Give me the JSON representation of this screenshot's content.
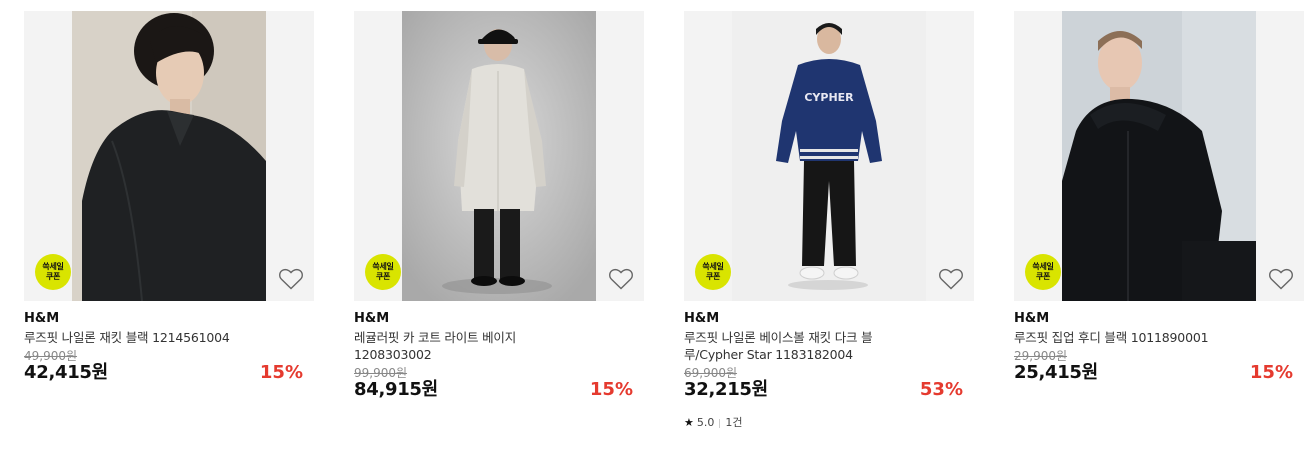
{
  "products": [
    {
      "brand": "H&M",
      "name": "루즈핏 나일론 재킷 블랙 1214561004",
      "original_price": "49,900원",
      "sale_price": "42,415원",
      "discount": "15%",
      "badge": [
        "쓱세일",
        "쿠폰"
      ]
    },
    {
      "brand": "H&M",
      "name": "레귤러핏 카 코트 라이트 베이지 1208303002",
      "original_price": "99,900원",
      "sale_price": "84,915원",
      "discount": "15%",
      "badge": [
        "쓱세일",
        "쿠폰"
      ]
    },
    {
      "brand": "H&M",
      "name": "루즈핏 나일론 베이스볼 재킷 다크 블루/Cypher Star 1183182004",
      "original_price": "69,900원",
      "sale_price": "32,215원",
      "discount": "53%",
      "badge": [
        "쓱세일",
        "쿠폰"
      ],
      "rating": "5.0",
      "review_count": "1건",
      "jacket_text": "CYPHER"
    },
    {
      "brand": "H&M",
      "name": "루즈핏 집업 후디 블랙 1011890001",
      "original_price": "29,900원",
      "sale_price": "25,415원",
      "discount": "15%",
      "badge": [
        "쓱세일",
        "쿠폰"
      ]
    }
  ],
  "colors": {
    "discount": "#e53a2f",
    "coupon_badge": "#d9e400",
    "image_bg": "#f3f3f3"
  },
  "icons": {
    "wishlist": "heart-outline-icon",
    "rating": "star-icon"
  }
}
